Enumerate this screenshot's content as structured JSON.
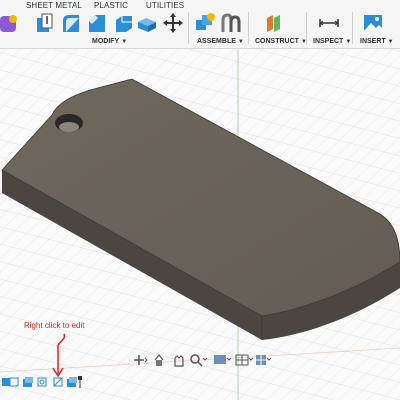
{
  "toolbar": {
    "tabs": [
      "SHEET METAL",
      "PLASTIC",
      "UTILITIES"
    ],
    "groups": [
      {
        "label": "MODIFY"
      },
      {
        "label": "ASSEMBLE"
      },
      {
        "label": "CONSTRUCT"
      },
      {
        "label": "INSPECT"
      },
      {
        "label": "INSERT"
      }
    ]
  },
  "annotation": {
    "text": "Right click to edit",
    "color": "#d9261c"
  },
  "colors": {
    "part_top": "#6b645b",
    "part_side": "#4a4640",
    "toolbar_bg": "#f5f5f5",
    "accent_blue": "#2b8fd6"
  },
  "icons": {
    "modify": [
      "press-pull-icon",
      "fillet-icon",
      "chamfer-icon",
      "shell-icon",
      "scale-icon",
      "move-icon"
    ],
    "assemble": [
      "new-component-icon",
      "joint-icon"
    ],
    "construct": [
      "offset-plane-icon"
    ],
    "inspect": [
      "measure-icon"
    ],
    "insert": [
      "insert-image-icon"
    ],
    "navbar": [
      "orbit-icon",
      "pan-icon",
      "look-at-icon",
      "zoom-icon",
      "display-settings-icon",
      "grid-settings-icon",
      "viewports-icon"
    ]
  }
}
